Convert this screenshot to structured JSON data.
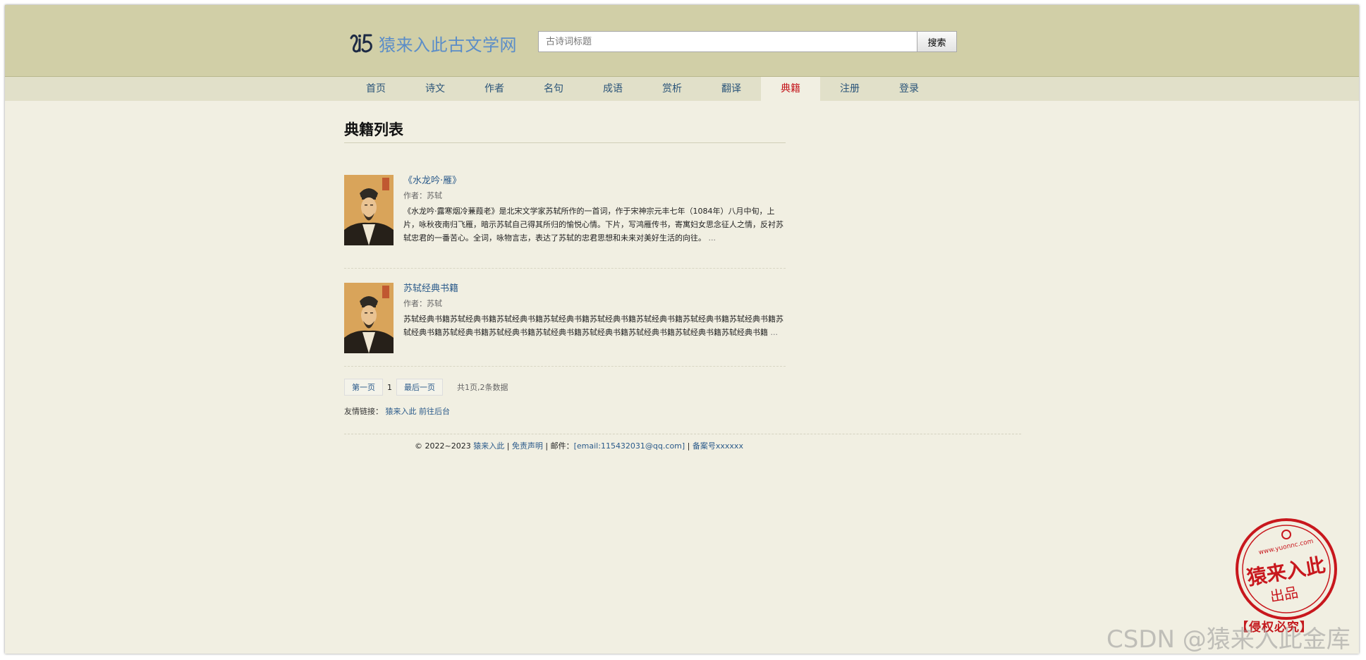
{
  "brand": {
    "name": "猿来入此古文学网"
  },
  "search": {
    "placeholder": "古诗词标题",
    "value": "",
    "button": "搜索"
  },
  "nav": [
    {
      "label": "首页"
    },
    {
      "label": "诗文"
    },
    {
      "label": "作者"
    },
    {
      "label": "名句"
    },
    {
      "label": "成语"
    },
    {
      "label": "赏析"
    },
    {
      "label": "翻译"
    },
    {
      "label": "典籍",
      "active": true
    },
    {
      "label": "注册"
    },
    {
      "label": "登录"
    }
  ],
  "page_title": "典籍列表",
  "books": [
    {
      "title": "《水龙吟·雁》",
      "author": "作者：苏轼",
      "desc": "《水龙吟·露寒烟冷蒹葭老》是北宋文学家苏轼所作的一首词，作于宋神宗元丰七年（1084年）八月中旬，上片，咏秋夜南归飞雁，暗示苏轼自己得其所归的愉悦心情。下片，写鸿雁传书，寄寓妇女思念征人之情，反衬苏轼忠君的一番苦心。全词，咏物言志，表达了苏轼的忠君思想和未来对美好生活的向往。",
      "more": "..."
    },
    {
      "title": "苏轼经典书籍",
      "author": "作者：苏轼",
      "desc": "苏轼经典书籍苏轼经典书籍苏轼经典书籍苏轼经典书籍苏轼经典书籍苏轼经典书籍苏轼经典书籍苏轼经典书籍苏轼经典书籍苏轼经典书籍苏轼经典书籍苏轼经典书籍苏轼经典书籍苏轼经典书籍苏轼经典书籍苏轼经典书籍",
      "more": "..."
    }
  ],
  "pager": {
    "first": "第一页",
    "current": "1",
    "last": "最后一页",
    "total": "共1页,2条数据"
  },
  "friend_links": {
    "label": "友情链接：",
    "links": [
      "猿来入此",
      "前往后台"
    ]
  },
  "footer": {
    "copyright": "© 2022~2023",
    "site": "猿来入此",
    "sep1": " | ",
    "disclaimer": "免责声明",
    "sep2": " | 邮件：",
    "email": "[email:115432031@qq.com]",
    "sep3": " | ",
    "icp": "备案号xxxxxx"
  },
  "stamp": {
    "text": "猿来入此",
    "subtext": "出品",
    "url": "www.yuonnc.com",
    "note": "【侵权必究】"
  },
  "watermark": "CSDN @猿来入此金库",
  "colors": {
    "header": "#d1cfa7",
    "nav": "#e1e0c9",
    "page": "#f1efe2",
    "link": "#2a5a8a",
    "active": "#c4161c"
  }
}
